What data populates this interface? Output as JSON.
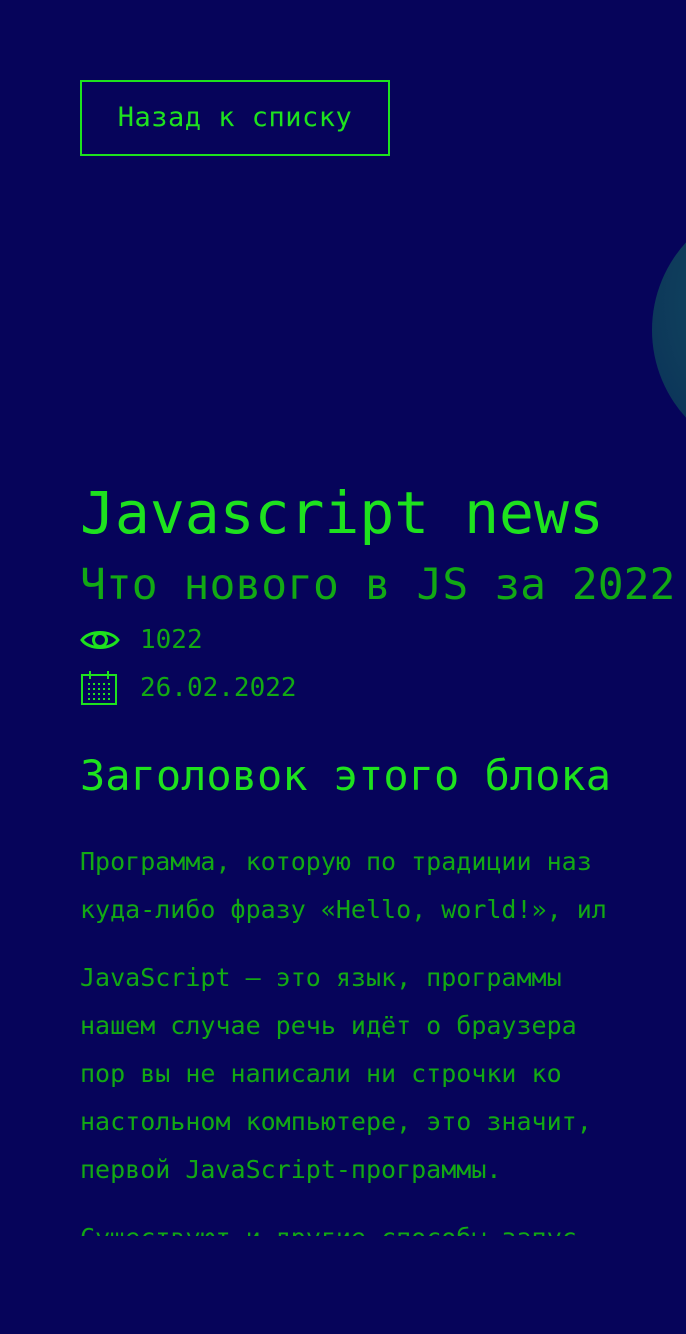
{
  "back_button": {
    "label": "Назад к списку"
  },
  "article": {
    "title": "Javascript news",
    "subtitle": "Что нового в JS за 2022",
    "views": "1022",
    "date": "26.02.2022",
    "block_heading": "Заголовок этого блока",
    "paragraphs": [
      {
        "lines": [
          "Программа, которую по традиции наз",
          "куда-либо фразу «Hello, world!», ил"
        ]
      },
      {
        "lines": [
          "JavaScript — это язык, программы",
          "нашем случае речь идёт о браузера",
          "пор вы не написали ни строчки ко",
          "настольном компьютере, это значит,",
          "первой JavaScript-программы."
        ]
      },
      {
        "lines": [
          "Существуют и другие способы запус"
        ]
      }
    ]
  },
  "icons": {
    "views": "eye-icon",
    "date": "calendar-icon"
  },
  "colors": {
    "background": "#06045a",
    "accent": "#1ee21e",
    "text": "#12a914"
  }
}
